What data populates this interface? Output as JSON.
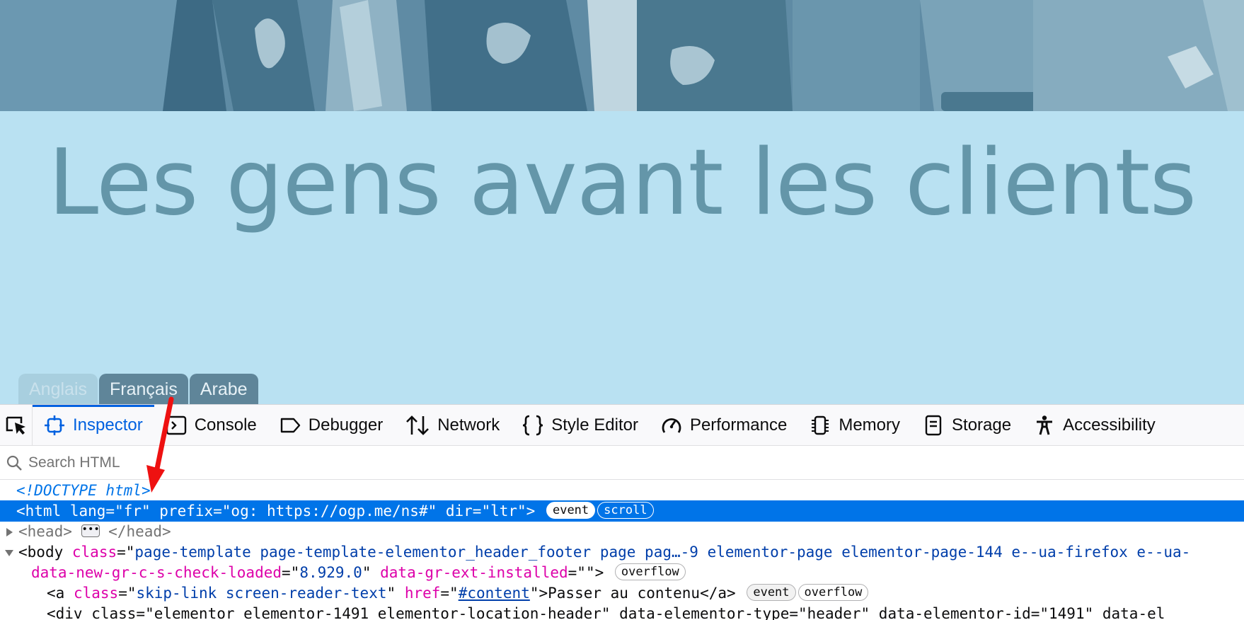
{
  "hero": {
    "title": "Les gens avant les clients"
  },
  "language_tabs": [
    {
      "label": "Anglais",
      "state": "inactive"
    },
    {
      "label": "Français",
      "state": "active"
    },
    {
      "label": "Arabe",
      "state": "active"
    }
  ],
  "devtools": {
    "tabs": [
      {
        "label": "Inspector",
        "icon": "inspector-icon",
        "active": true
      },
      {
        "label": "Console",
        "icon": "console-icon"
      },
      {
        "label": "Debugger",
        "icon": "debugger-icon"
      },
      {
        "label": "Network",
        "icon": "network-icon"
      },
      {
        "label": "Style Editor",
        "icon": "style-editor-icon"
      },
      {
        "label": "Performance",
        "icon": "performance-icon"
      },
      {
        "label": "Memory",
        "icon": "memory-icon"
      },
      {
        "label": "Storage",
        "icon": "storage-icon"
      },
      {
        "label": "Accessibility",
        "icon": "accessibility-icon"
      }
    ],
    "search_placeholder": "Search HTML",
    "tree": {
      "doctype": "<!DOCTYPE html>",
      "html_line": {
        "open": "<html",
        "attrs": " lang=\"fr\" prefix=\"og: https://ogp.me/ns#\" dir=\"ltr\">",
        "badges": [
          "event",
          "scroll"
        ]
      },
      "head_line": {
        "open": "<head>",
        "close": "</head>"
      },
      "body_line": {
        "tag": "body",
        "attr1_name": "class",
        "attr1_value": "page-template page-template-elementor_header_footer page pag…-9 elementor-page elementor-page-144 e--ua-firefox e--ua-",
        "attr2_name": "data-new-gr-c-s-check-loaded",
        "attr2_value": "8.929.0",
        "attr3_name": "data-gr-ext-installed",
        "attr3_value": "",
        "badge": "overflow"
      },
      "a_line": {
        "tag": "a",
        "class_name": "class",
        "class_value": "skip-link screen-reader-text",
        "href_name": "href",
        "href_value": "#content",
        "text": "Passer au contenu",
        "badges": [
          "event",
          "overflow"
        ]
      },
      "partial_line": "<div class=\"elementor elementor-1491 elementor-location-header\" data-elementor-type=\"header\" data-elementor-id=\"1491\" data-el"
    }
  },
  "colors": {
    "hero_band": "#b9e1f2",
    "hero_title": "#6496a9",
    "devtools_accent": "#0061e0",
    "selection": "#0074e8",
    "annotation_arrow": "#ee1111"
  }
}
